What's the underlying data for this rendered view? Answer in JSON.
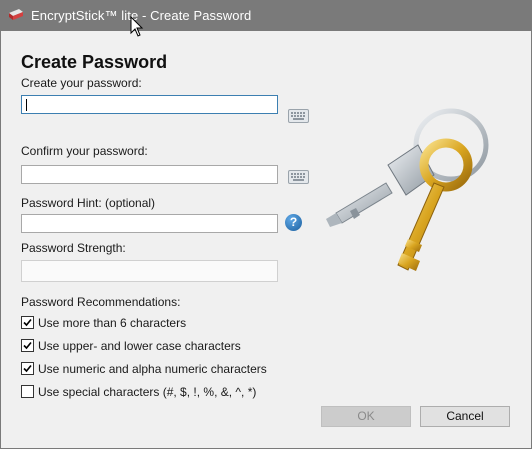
{
  "window": {
    "title": "EncryptStick™ lite - Create Password"
  },
  "dialog": {
    "heading": "Create Password",
    "create_label": "Create your password:",
    "confirm_label": "Confirm your password:",
    "hint_label": "Password Hint: (optional)",
    "strength_label": "Password Strength:",
    "help_glyph": "?",
    "recommendations_label": "Password Recommendations:",
    "fields": {
      "create_value": "",
      "confirm_value": "",
      "hint_value": "",
      "strength_value": ""
    },
    "recommendations": [
      {
        "label": "Use more than 6 characters",
        "checked": true
      },
      {
        "label": "Use upper- and lower case characters",
        "checked": true
      },
      {
        "label": "Use numeric and alpha numeric characters",
        "checked": true
      },
      {
        "label": "Use special characters (#, $, !, %, &, ^, *)",
        "checked": false
      }
    ]
  },
  "buttons": {
    "ok_label": "OK",
    "ok_enabled": false,
    "cancel_label": "Cancel"
  },
  "icons": {
    "app": "encryptstick-app-icon",
    "keyboard": "keyboard-icon",
    "help": "help-icon",
    "illustration": "keys-illustration"
  },
  "colors": {
    "titlebar": "#7a7a7a",
    "background": "#f0f0f0",
    "focus_border": "#3c7fb1",
    "help_blue": "#1c5f9e",
    "key_silver": "#b8bfc6",
    "key_gold": "#d9a520"
  }
}
